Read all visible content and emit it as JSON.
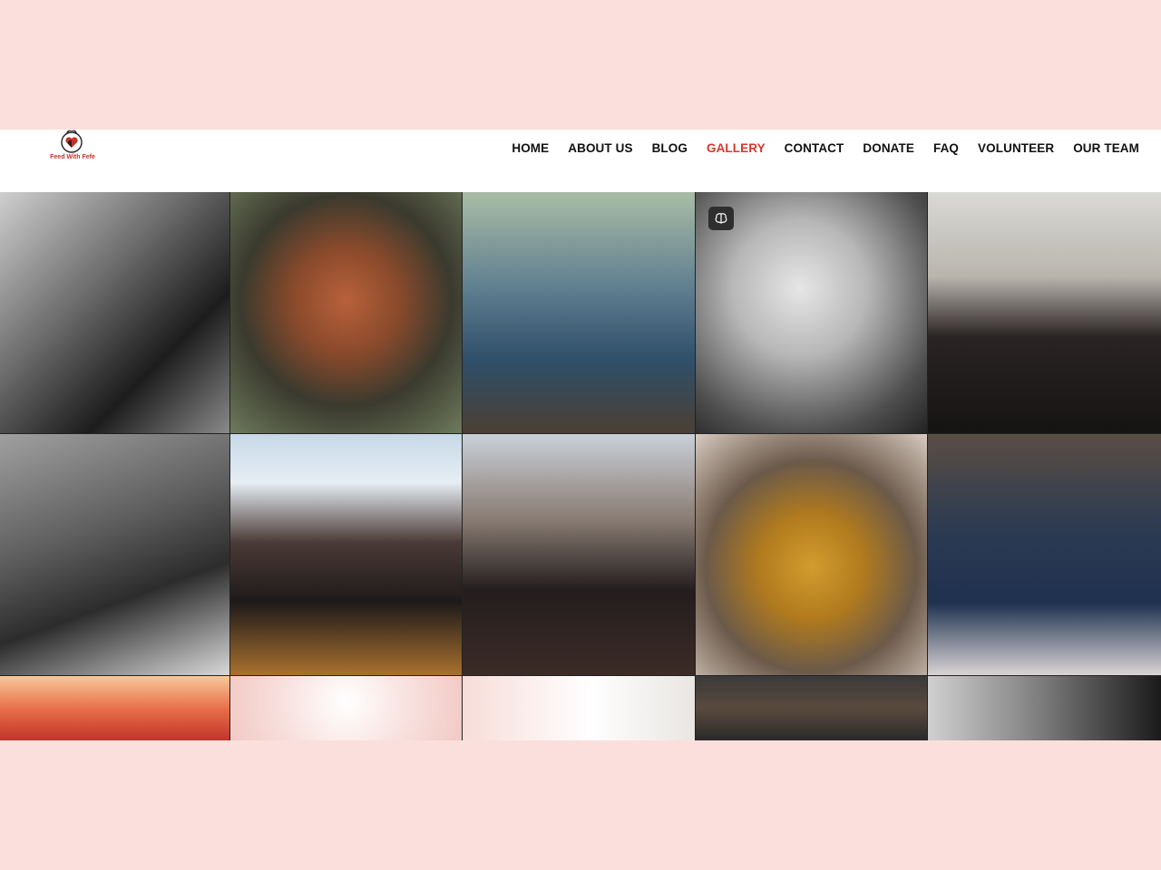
{
  "site": {
    "logo_text": "Feed With Fefe"
  },
  "nav": {
    "items": [
      {
        "label": "HOME",
        "active": false
      },
      {
        "label": "ABOUT US",
        "active": false
      },
      {
        "label": "BLOG",
        "active": false
      },
      {
        "label": "GALLERY",
        "active": true
      },
      {
        "label": "CONTACT",
        "active": false
      },
      {
        "label": "DONATE",
        "active": false
      },
      {
        "label": "FAQ",
        "active": false
      },
      {
        "label": "VOLUNTEER",
        "active": false
      },
      {
        "label": "OUR TEAM",
        "active": false
      }
    ]
  },
  "colors": {
    "page_bg": "#fbdfdc",
    "header_bg": "#ffffff",
    "nav_text": "#111111",
    "nav_active": "#d8352c",
    "brand_red": "#c8302a"
  },
  "gallery": {
    "tiles": [
      {
        "name": "photo-bw-boys-peace-sign",
        "bg": "linear-gradient(135deg,#cfcfcf 0%,#6b6b6b 40%,#1c1c1c 70%,#8a8a8a 100%)"
      },
      {
        "name": "photo-boy-orange-shirt",
        "bg": "radial-gradient(circle at 50% 45%,#b8613a 0%,#8a4a2c 30%,#3a3a2e 60%,#6e7a5c 100%)"
      },
      {
        "name": "photo-children-group-street",
        "bg": "linear-gradient(180deg,#a9bca6 0%,#5f7e8f 40%,#2f4f6a 70%,#4b3f33 100%)"
      },
      {
        "name": "photo-bw-girl-hijab",
        "bg": "radial-gradient(circle at 45% 40%,#e6e6e6 0%,#b7b7b7 35%,#4f4f4f 75%,#222 100%)",
        "badge": true
      },
      {
        "name": "photo-volunteers-team-shirts",
        "bg": "linear-gradient(180deg,#d9d9d6 0%,#b9b5ad 35%,#2a2424 60%,#161313 100%)"
      },
      {
        "name": "photo-bw-woman-sunglasses",
        "bg": "linear-gradient(160deg,#a0a0a0 0%,#5e5e5e 40%,#2c2c2c 65%,#d9d9d9 100%)"
      },
      {
        "name": "photo-volunteer-umbrella-outreach",
        "bg": "linear-gradient(180deg,#c7d8e8 0%,#e6eef4 20%,#4a3a36 45%,#1e1a1a 70%,#a9712e 100%)"
      },
      {
        "name": "photo-two-volunteers-smiling",
        "bg": "linear-gradient(180deg,#c9d0d8 0%,#8a7d74 35%,#231d1d 65%,#3c2b27 100%)"
      },
      {
        "name": "photo-child-rice-bag",
        "bg": "radial-gradient(circle at 50% 55%,#d39c2e 0%,#b07a1e 30%,#6b5a4a 60%,#d9cbc2 100%)"
      },
      {
        "name": "photo-school-children-group",
        "bg": "linear-gradient(180deg,#5a4e44 0%,#2c3a52 40%,#1f3150 70%,#d9d4d4 100%)"
      },
      {
        "name": "poster-christmas-event",
        "bg": "linear-gradient(180deg,#f7c89a 0%,#e9704a 50%,#c1342b 100%)"
      },
      {
        "name": "poster-feed-with-fefe-pink",
        "bg": "radial-gradient(circle at 50% 40%,#ffffff 0%,#f8e2df 50%,#f2c9c4 100%)"
      },
      {
        "name": "poster-feed-with-fefe-rice",
        "bg": "linear-gradient(90deg,#f7ddd8 0%,#ffffff 55%,#e9e6e2 100%)"
      },
      {
        "name": "photo-outreach-street-scene",
        "bg": "linear-gradient(180deg,#3a3a3a 0%,#5a4a3e 50%,#2a2a2a 100%)"
      },
      {
        "name": "photo-bw-man-portrait",
        "bg": "linear-gradient(90deg,#d0d0d0 0%,#7a7a7a 50%,#1a1a1a 100%)"
      }
    ]
  }
}
